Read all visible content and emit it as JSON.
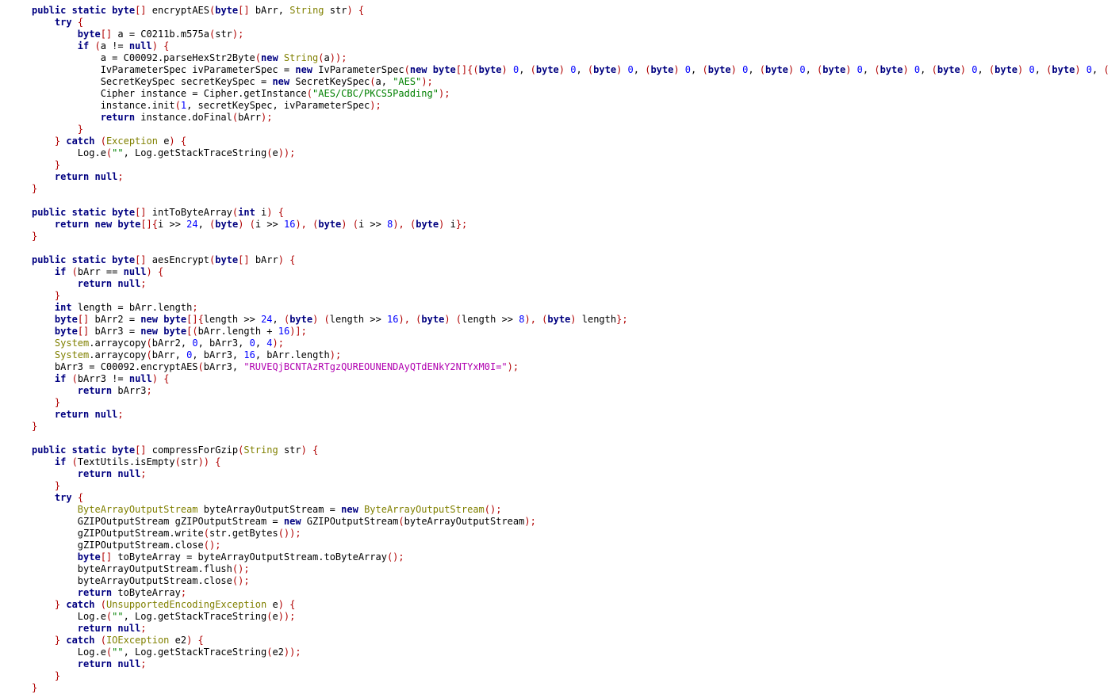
{
  "colors": {
    "background": "#ffffff",
    "keyword": "#000080",
    "type": "#808000",
    "string": "#008000",
    "base64_string": "#b000b0",
    "number": "#0000ff",
    "punctuation": "#b00000",
    "plain": "#000000"
  },
  "lines": [
    [
      [
        "kw",
        "public static "
      ],
      [
        "kw",
        "byte"
      ],
      [
        "punc",
        "[] "
      ],
      [
        "plain",
        "encryptAES"
      ],
      [
        "punc",
        "("
      ],
      [
        "kw",
        "byte"
      ],
      [
        "punc",
        "[] "
      ],
      [
        "plain",
        "bArr, "
      ],
      [
        "type",
        "String"
      ],
      [
        "plain",
        " str"
      ],
      [
        "punc",
        ") {"
      ]
    ],
    [
      [
        "plain",
        "    "
      ],
      [
        "kw",
        "try"
      ],
      [
        "punc",
        " {"
      ]
    ],
    [
      [
        "plain",
        "        "
      ],
      [
        "kw",
        "byte"
      ],
      [
        "punc",
        "[] "
      ],
      [
        "plain",
        "a = C0211b.m575a"
      ],
      [
        "punc",
        "("
      ],
      [
        "plain",
        "str"
      ],
      [
        "punc",
        ");"
      ]
    ],
    [
      [
        "plain",
        "        "
      ],
      [
        "kw",
        "if"
      ],
      [
        "punc",
        " ("
      ],
      [
        "plain",
        "a != "
      ],
      [
        "kw",
        "null"
      ],
      [
        "punc",
        ") {"
      ]
    ],
    [
      [
        "plain",
        "            a = C00092.parseHexStr2Byte"
      ],
      [
        "punc",
        "("
      ],
      [
        "kw",
        "new"
      ],
      [
        "plain",
        " "
      ],
      [
        "type",
        "String"
      ],
      [
        "punc",
        "("
      ],
      [
        "plain",
        "a"
      ],
      [
        "punc",
        "));"
      ]
    ],
    [
      [
        "plain",
        "            IvParameterSpec ivParameterSpec = "
      ],
      [
        "kw",
        "new"
      ],
      [
        "plain",
        " IvParameterSpec"
      ],
      [
        "punc",
        "("
      ],
      [
        "kw",
        "new"
      ],
      [
        "plain",
        " "
      ],
      [
        "kw",
        "byte"
      ],
      [
        "punc",
        "[]{("
      ],
      [
        "kw",
        "byte"
      ],
      [
        "punc",
        ") "
      ],
      [
        "num",
        "0"
      ],
      [
        "plain",
        ", "
      ],
      [
        "punc",
        "("
      ],
      [
        "kw",
        "byte"
      ],
      [
        "punc",
        ") "
      ],
      [
        "num",
        "0"
      ],
      [
        "plain",
        ", "
      ],
      [
        "punc",
        "("
      ],
      [
        "kw",
        "byte"
      ],
      [
        "punc",
        ") "
      ],
      [
        "num",
        "0"
      ],
      [
        "plain",
        ", "
      ],
      [
        "punc",
        "("
      ],
      [
        "kw",
        "byte"
      ],
      [
        "punc",
        ") "
      ],
      [
        "num",
        "0"
      ],
      [
        "plain",
        ", "
      ],
      [
        "punc",
        "("
      ],
      [
        "kw",
        "byte"
      ],
      [
        "punc",
        ") "
      ],
      [
        "num",
        "0"
      ],
      [
        "plain",
        ", "
      ],
      [
        "punc",
        "("
      ],
      [
        "kw",
        "byte"
      ],
      [
        "punc",
        ") "
      ],
      [
        "num",
        "0"
      ],
      [
        "plain",
        ", "
      ],
      [
        "punc",
        "("
      ],
      [
        "kw",
        "byte"
      ],
      [
        "punc",
        ") "
      ],
      [
        "num",
        "0"
      ],
      [
        "plain",
        ", "
      ],
      [
        "punc",
        "("
      ],
      [
        "kw",
        "byte"
      ],
      [
        "punc",
        ") "
      ],
      [
        "num",
        "0"
      ],
      [
        "plain",
        ", "
      ],
      [
        "punc",
        "("
      ],
      [
        "kw",
        "byte"
      ],
      [
        "punc",
        ") "
      ],
      [
        "num",
        "0"
      ],
      [
        "plain",
        ", "
      ],
      [
        "punc",
        "("
      ],
      [
        "kw",
        "byte"
      ],
      [
        "punc",
        ") "
      ],
      [
        "num",
        "0"
      ],
      [
        "plain",
        ", "
      ],
      [
        "punc",
        "("
      ],
      [
        "kw",
        "byte"
      ],
      [
        "punc",
        ") "
      ],
      [
        "num",
        "0"
      ],
      [
        "plain",
        ", "
      ],
      [
        "punc",
        "("
      ]
    ],
    [
      [
        "plain",
        "            SecretKeySpec secretKeySpec = "
      ],
      [
        "kw",
        "new"
      ],
      [
        "plain",
        " SecretKeySpec"
      ],
      [
        "punc",
        "("
      ],
      [
        "plain",
        "a, "
      ],
      [
        "str",
        "\"AES\""
      ],
      [
        "punc",
        ");"
      ]
    ],
    [
      [
        "plain",
        "            Cipher instance = Cipher.getInstance"
      ],
      [
        "punc",
        "("
      ],
      [
        "str",
        "\"AES/CBC/PKCS5Padding\""
      ],
      [
        "punc",
        ");"
      ]
    ],
    [
      [
        "plain",
        "            instance.init"
      ],
      [
        "punc",
        "("
      ],
      [
        "num",
        "1"
      ],
      [
        "plain",
        ", secretKeySpec, ivParameterSpec"
      ],
      [
        "punc",
        ");"
      ]
    ],
    [
      [
        "plain",
        "            "
      ],
      [
        "kw",
        "return"
      ],
      [
        "plain",
        " instance.doFinal"
      ],
      [
        "punc",
        "("
      ],
      [
        "plain",
        "bArr"
      ],
      [
        "punc",
        ");"
      ]
    ],
    [
      [
        "plain",
        "        "
      ],
      [
        "punc",
        "}"
      ]
    ],
    [
      [
        "plain",
        "    "
      ],
      [
        "punc",
        "} "
      ],
      [
        "kw",
        "catch"
      ],
      [
        "punc",
        " ("
      ],
      [
        "type",
        "Exception"
      ],
      [
        "plain",
        " e"
      ],
      [
        "punc",
        ") {"
      ]
    ],
    [
      [
        "plain",
        "        Log.e"
      ],
      [
        "punc",
        "("
      ],
      [
        "str",
        "\"\""
      ],
      [
        "plain",
        ", Log.getStackTraceString"
      ],
      [
        "punc",
        "("
      ],
      [
        "plain",
        "e"
      ],
      [
        "punc",
        "));"
      ]
    ],
    [
      [
        "plain",
        "    "
      ],
      [
        "punc",
        "}"
      ]
    ],
    [
      [
        "plain",
        "    "
      ],
      [
        "kw",
        "return"
      ],
      [
        "plain",
        " "
      ],
      [
        "kw",
        "null"
      ],
      [
        "punc",
        ";"
      ]
    ],
    [
      [
        "punc",
        "}"
      ]
    ],
    [],
    [
      [
        "kw",
        "public static "
      ],
      [
        "kw",
        "byte"
      ],
      [
        "punc",
        "[] "
      ],
      [
        "plain",
        "intToByteArray"
      ],
      [
        "punc",
        "("
      ],
      [
        "kw",
        "int"
      ],
      [
        "plain",
        " i"
      ],
      [
        "punc",
        ") {"
      ]
    ],
    [
      [
        "plain",
        "    "
      ],
      [
        "kw",
        "return"
      ],
      [
        "plain",
        " "
      ],
      [
        "kw",
        "new"
      ],
      [
        "plain",
        " "
      ],
      [
        "kw",
        "byte"
      ],
      [
        "punc",
        "[]{"
      ],
      [
        "plain",
        "i >> "
      ],
      [
        "num",
        "24"
      ],
      [
        "plain",
        ", "
      ],
      [
        "punc",
        "("
      ],
      [
        "kw",
        "byte"
      ],
      [
        "punc",
        ") ("
      ],
      [
        "plain",
        "i >> "
      ],
      [
        "num",
        "16"
      ],
      [
        "punc",
        "), ("
      ],
      [
        "kw",
        "byte"
      ],
      [
        "punc",
        ") ("
      ],
      [
        "plain",
        "i >> "
      ],
      [
        "num",
        "8"
      ],
      [
        "punc",
        "), ("
      ],
      [
        "kw",
        "byte"
      ],
      [
        "punc",
        ") "
      ],
      [
        "plain",
        "i"
      ],
      [
        "punc",
        "};"
      ]
    ],
    [
      [
        "punc",
        "}"
      ]
    ],
    [],
    [
      [
        "kw",
        "public static "
      ],
      [
        "kw",
        "byte"
      ],
      [
        "punc",
        "[] "
      ],
      [
        "plain",
        "aesEncrypt"
      ],
      [
        "punc",
        "("
      ],
      [
        "kw",
        "byte"
      ],
      [
        "punc",
        "[] "
      ],
      [
        "plain",
        "bArr"
      ],
      [
        "punc",
        ") {"
      ]
    ],
    [
      [
        "plain",
        "    "
      ],
      [
        "kw",
        "if"
      ],
      [
        "punc",
        " ("
      ],
      [
        "plain",
        "bArr == "
      ],
      [
        "kw",
        "null"
      ],
      [
        "punc",
        ") {"
      ]
    ],
    [
      [
        "plain",
        "        "
      ],
      [
        "kw",
        "return"
      ],
      [
        "plain",
        " "
      ],
      [
        "kw",
        "null"
      ],
      [
        "punc",
        ";"
      ]
    ],
    [
      [
        "plain",
        "    "
      ],
      [
        "punc",
        "}"
      ]
    ],
    [
      [
        "plain",
        "    "
      ],
      [
        "kw",
        "int"
      ],
      [
        "plain",
        " length = bArr.length"
      ],
      [
        "punc",
        ";"
      ]
    ],
    [
      [
        "plain",
        "    "
      ],
      [
        "kw",
        "byte"
      ],
      [
        "punc",
        "[] "
      ],
      [
        "plain",
        "bArr2 = "
      ],
      [
        "kw",
        "new"
      ],
      [
        "plain",
        " "
      ],
      [
        "kw",
        "byte"
      ],
      [
        "punc",
        "[]{"
      ],
      [
        "plain",
        "length >> "
      ],
      [
        "num",
        "24"
      ],
      [
        "plain",
        ", "
      ],
      [
        "punc",
        "("
      ],
      [
        "kw",
        "byte"
      ],
      [
        "punc",
        ") ("
      ],
      [
        "plain",
        "length >> "
      ],
      [
        "num",
        "16"
      ],
      [
        "punc",
        "), ("
      ],
      [
        "kw",
        "byte"
      ],
      [
        "punc",
        ") ("
      ],
      [
        "plain",
        "length >> "
      ],
      [
        "num",
        "8"
      ],
      [
        "punc",
        "), ("
      ],
      [
        "kw",
        "byte"
      ],
      [
        "punc",
        ") "
      ],
      [
        "plain",
        "length"
      ],
      [
        "punc",
        "};"
      ]
    ],
    [
      [
        "plain",
        "    "
      ],
      [
        "kw",
        "byte"
      ],
      [
        "punc",
        "[] "
      ],
      [
        "plain",
        "bArr3 = "
      ],
      [
        "kw",
        "new"
      ],
      [
        "plain",
        " "
      ],
      [
        "kw",
        "byte"
      ],
      [
        "punc",
        "[("
      ],
      [
        "plain",
        "bArr.length + "
      ],
      [
        "num",
        "16"
      ],
      [
        "punc",
        ")];"
      ]
    ],
    [
      [
        "plain",
        "    "
      ],
      [
        "type",
        "System"
      ],
      [
        "plain",
        ".arraycopy"
      ],
      [
        "punc",
        "("
      ],
      [
        "plain",
        "bArr2, "
      ],
      [
        "num",
        "0"
      ],
      [
        "plain",
        ", bArr3, "
      ],
      [
        "num",
        "0"
      ],
      [
        "plain",
        ", "
      ],
      [
        "num",
        "4"
      ],
      [
        "punc",
        ");"
      ]
    ],
    [
      [
        "plain",
        "    "
      ],
      [
        "type",
        "System"
      ],
      [
        "plain",
        ".arraycopy"
      ],
      [
        "punc",
        "("
      ],
      [
        "plain",
        "bArr, "
      ],
      [
        "num",
        "0"
      ],
      [
        "plain",
        ", bArr3, "
      ],
      [
        "num",
        "16"
      ],
      [
        "plain",
        ", bArr.length"
      ],
      [
        "punc",
        ");"
      ]
    ],
    [
      [
        "plain",
        "    bArr3 = C00092.encryptAES"
      ],
      [
        "punc",
        "("
      ],
      [
        "plain",
        "bArr3, "
      ],
      [
        "str2",
        "\"RUVEQjBCNTAzRTgzQUREOUNENDAyQTdENkY2NTYxM0I=\""
      ],
      [
        "punc",
        ");"
      ]
    ],
    [
      [
        "plain",
        "    "
      ],
      [
        "kw",
        "if"
      ],
      [
        "punc",
        " ("
      ],
      [
        "plain",
        "bArr3 != "
      ],
      [
        "kw",
        "null"
      ],
      [
        "punc",
        ") {"
      ]
    ],
    [
      [
        "plain",
        "        "
      ],
      [
        "kw",
        "return"
      ],
      [
        "plain",
        " bArr3"
      ],
      [
        "punc",
        ";"
      ]
    ],
    [
      [
        "plain",
        "    "
      ],
      [
        "punc",
        "}"
      ]
    ],
    [
      [
        "plain",
        "    "
      ],
      [
        "kw",
        "return"
      ],
      [
        "plain",
        " "
      ],
      [
        "kw",
        "null"
      ],
      [
        "punc",
        ";"
      ]
    ],
    [
      [
        "punc",
        "}"
      ]
    ],
    [],
    [
      [
        "kw",
        "public static "
      ],
      [
        "kw",
        "byte"
      ],
      [
        "punc",
        "[] "
      ],
      [
        "plain",
        "compressForGzip"
      ],
      [
        "punc",
        "("
      ],
      [
        "type",
        "String"
      ],
      [
        "plain",
        " str"
      ],
      [
        "punc",
        ") {"
      ]
    ],
    [
      [
        "plain",
        "    "
      ],
      [
        "kw",
        "if"
      ],
      [
        "punc",
        " ("
      ],
      [
        "plain",
        "TextUtils.isEmpty"
      ],
      [
        "punc",
        "("
      ],
      [
        "plain",
        "str"
      ],
      [
        "punc",
        ")) {"
      ]
    ],
    [
      [
        "plain",
        "        "
      ],
      [
        "kw",
        "return"
      ],
      [
        "plain",
        " "
      ],
      [
        "kw",
        "null"
      ],
      [
        "punc",
        ";"
      ]
    ],
    [
      [
        "plain",
        "    "
      ],
      [
        "punc",
        "}"
      ]
    ],
    [
      [
        "plain",
        "    "
      ],
      [
        "kw",
        "try"
      ],
      [
        "punc",
        " {"
      ]
    ],
    [
      [
        "plain",
        "        "
      ],
      [
        "type",
        "ByteArrayOutputStream"
      ],
      [
        "plain",
        " byteArrayOutputStream = "
      ],
      [
        "kw",
        "new"
      ],
      [
        "plain",
        " "
      ],
      [
        "type",
        "ByteArrayOutputStream"
      ],
      [
        "punc",
        "();"
      ]
    ],
    [
      [
        "plain",
        "        GZIPOutputStream gZIPOutputStream = "
      ],
      [
        "kw",
        "new"
      ],
      [
        "plain",
        " GZIPOutputStream"
      ],
      [
        "punc",
        "("
      ],
      [
        "plain",
        "byteArrayOutputStream"
      ],
      [
        "punc",
        ");"
      ]
    ],
    [
      [
        "plain",
        "        gZIPOutputStream.write"
      ],
      [
        "punc",
        "("
      ],
      [
        "plain",
        "str.getBytes"
      ],
      [
        "punc",
        "());"
      ]
    ],
    [
      [
        "plain",
        "        gZIPOutputStream.close"
      ],
      [
        "punc",
        "();"
      ]
    ],
    [
      [
        "plain",
        "        "
      ],
      [
        "kw",
        "byte"
      ],
      [
        "punc",
        "[] "
      ],
      [
        "plain",
        "toByteArray = byteArrayOutputStream.toByteArray"
      ],
      [
        "punc",
        "();"
      ]
    ],
    [
      [
        "plain",
        "        byteArrayOutputStream.flush"
      ],
      [
        "punc",
        "();"
      ]
    ],
    [
      [
        "plain",
        "        byteArrayOutputStream.close"
      ],
      [
        "punc",
        "();"
      ]
    ],
    [
      [
        "plain",
        "        "
      ],
      [
        "kw",
        "return"
      ],
      [
        "plain",
        " toByteArray"
      ],
      [
        "punc",
        ";"
      ]
    ],
    [
      [
        "plain",
        "    "
      ],
      [
        "punc",
        "} "
      ],
      [
        "kw",
        "catch"
      ],
      [
        "punc",
        " ("
      ],
      [
        "type",
        "UnsupportedEncodingException"
      ],
      [
        "plain",
        " e"
      ],
      [
        "punc",
        ") {"
      ]
    ],
    [
      [
        "plain",
        "        Log.e"
      ],
      [
        "punc",
        "("
      ],
      [
        "str",
        "\"\""
      ],
      [
        "plain",
        ", Log.getStackTraceString"
      ],
      [
        "punc",
        "("
      ],
      [
        "plain",
        "e"
      ],
      [
        "punc",
        "));"
      ]
    ],
    [
      [
        "plain",
        "        "
      ],
      [
        "kw",
        "return"
      ],
      [
        "plain",
        " "
      ],
      [
        "kw",
        "null"
      ],
      [
        "punc",
        ";"
      ]
    ],
    [
      [
        "plain",
        "    "
      ],
      [
        "punc",
        "} "
      ],
      [
        "kw",
        "catch"
      ],
      [
        "punc",
        " ("
      ],
      [
        "type",
        "IOException"
      ],
      [
        "plain",
        " e2"
      ],
      [
        "punc",
        ") {"
      ]
    ],
    [
      [
        "plain",
        "        Log.e"
      ],
      [
        "punc",
        "("
      ],
      [
        "str",
        "\"\""
      ],
      [
        "plain",
        ", Log.getStackTraceString"
      ],
      [
        "punc",
        "("
      ],
      [
        "plain",
        "e2"
      ],
      [
        "punc",
        "));"
      ]
    ],
    [
      [
        "plain",
        "        "
      ],
      [
        "kw",
        "return"
      ],
      [
        "plain",
        " "
      ],
      [
        "kw",
        "null"
      ],
      [
        "punc",
        ";"
      ]
    ],
    [
      [
        "plain",
        "    "
      ],
      [
        "punc",
        "}"
      ]
    ],
    [
      [
        "punc",
        "}"
      ]
    ]
  ]
}
